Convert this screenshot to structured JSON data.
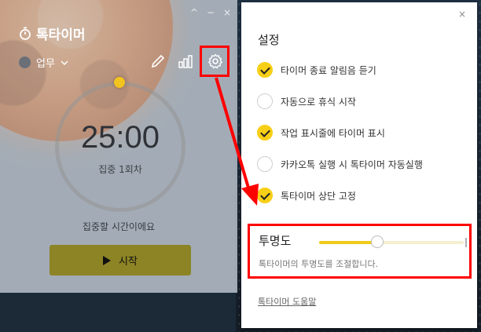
{
  "timer": {
    "title": "톡타이머",
    "window_controls": [
      "^",
      "−",
      "×"
    ],
    "category": "업무",
    "time": "25:00",
    "session": "집중 1회차",
    "message": "집중할 시간이에요",
    "start_label": "시작",
    "progress": 0
  },
  "settings": {
    "close": "×",
    "title": "설정",
    "options": [
      {
        "label": "타이머 종료 알림음 듣기",
        "checked": true
      },
      {
        "label": "자동으로 휴식 시작",
        "checked": false
      },
      {
        "label": "작업 표시줄에 타이머 표시",
        "checked": true
      },
      {
        "label": "카카오톡 실행 시 톡타이머 자동실행",
        "checked": false
      },
      {
        "label": "톡타이머 상단 고정",
        "checked": true
      }
    ],
    "opacity": {
      "title": "투명도",
      "description": "톡타이머의 투명도를 조절합니다.",
      "value_percent": 40
    },
    "help_link": "톡타이머 도움말"
  },
  "colors": {
    "accent": "#f7cf16",
    "annotation": "#ff0000",
    "start_button": "#8c8425"
  },
  "icons": [
    "stopwatch-icon",
    "chevron-down-icon",
    "pencil-icon",
    "bar-chart-icon",
    "gear-icon",
    "play-icon",
    "close-icon"
  ]
}
